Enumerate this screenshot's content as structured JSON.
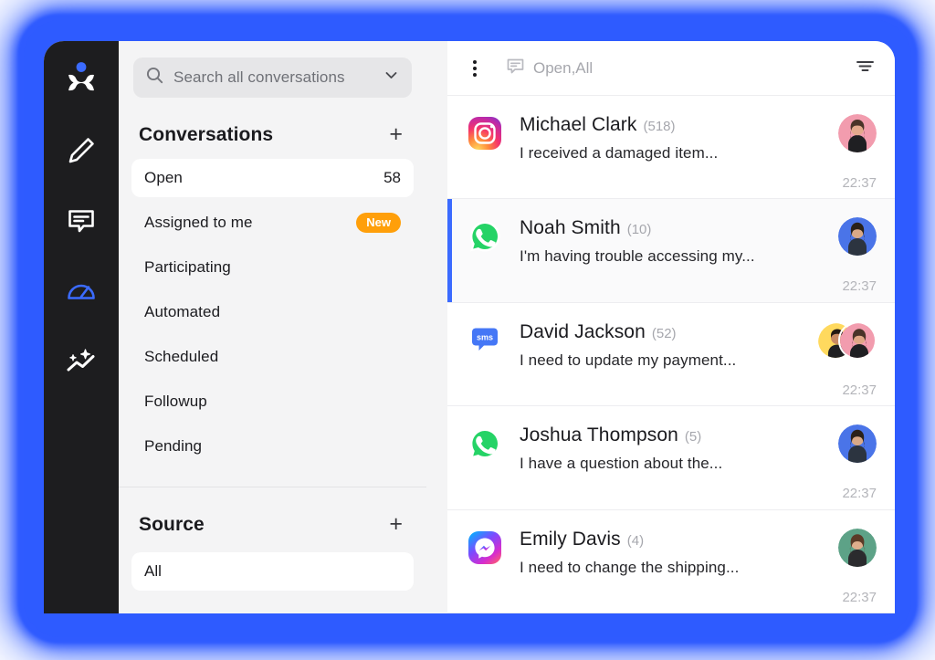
{
  "rail": {
    "items": [
      {
        "icon": "logo-person-icon",
        "name": "app-logo"
      },
      {
        "icon": "pencil-icon",
        "name": "compose"
      },
      {
        "icon": "chat-bubble-icon",
        "name": "conversations"
      },
      {
        "icon": "gauge-icon",
        "name": "dashboard"
      },
      {
        "icon": "sparkle-trend-icon",
        "name": "insights"
      }
    ],
    "accent_color": "#3b6bff",
    "background": "#1d1d1f"
  },
  "search": {
    "placeholder": "Search all conversations",
    "value": "",
    "icon": "search-icon",
    "chevron": "chevron-down-icon"
  },
  "sidebar": {
    "conversations": {
      "title": "Conversations",
      "add_label": "+",
      "items": [
        {
          "label": "Open",
          "count": "58",
          "active": true,
          "badge": ""
        },
        {
          "label": "Assigned to me",
          "count": "",
          "active": false,
          "badge": "New"
        },
        {
          "label": "Participating",
          "count": "",
          "active": false,
          "badge": ""
        },
        {
          "label": "Automated",
          "count": "",
          "active": false,
          "badge": ""
        },
        {
          "label": "Scheduled",
          "count": "",
          "active": false,
          "badge": ""
        },
        {
          "label": "Followup",
          "count": "",
          "active": false,
          "badge": ""
        },
        {
          "label": "Pending",
          "count": "",
          "active": false,
          "badge": ""
        }
      ]
    },
    "source": {
      "title": "Source",
      "add_label": "+",
      "selected": "All"
    },
    "badge_color": "#ff9f0a"
  },
  "list_header": {
    "menu_icon": "kebab-menu-icon",
    "filter_icon": "chat-filter-icon",
    "filter_label": "Open,All",
    "sort_icon": "filter-lines-icon"
  },
  "conversations": [
    {
      "channel": "instagram",
      "name": "Michael Clark",
      "count": "(518)",
      "preview": "I received a damaged item...",
      "time": "22:37",
      "selected": false,
      "avatars": [
        "pink"
      ]
    },
    {
      "channel": "whatsapp",
      "name": "Noah Smith",
      "count": "(10)",
      "preview": "I'm having trouble accessing my...",
      "time": "22:37",
      "selected": true,
      "avatars": [
        "blue"
      ]
    },
    {
      "channel": "sms",
      "name": "David Jackson",
      "count": "(52)",
      "preview": "I need to update my payment...",
      "time": "22:37",
      "selected": false,
      "avatars": [
        "yellow",
        "pink"
      ]
    },
    {
      "channel": "whatsapp",
      "name": "Joshua Thompson",
      "count": "(5)",
      "preview": "I have a question about the...",
      "time": "22:37",
      "selected": false,
      "avatars": [
        "blue"
      ]
    },
    {
      "channel": "messenger",
      "name": "Emily Davis",
      "count": "(4)",
      "preview": "I need to change the shipping...",
      "time": "22:37",
      "selected": false,
      "avatars": [
        "green"
      ]
    }
  ],
  "theme": {
    "glow": "#2f5bff",
    "selected_accent": "#3b6bff",
    "sidebar_bg": "#f4f4f5",
    "panel_bg": "#ffffff"
  }
}
